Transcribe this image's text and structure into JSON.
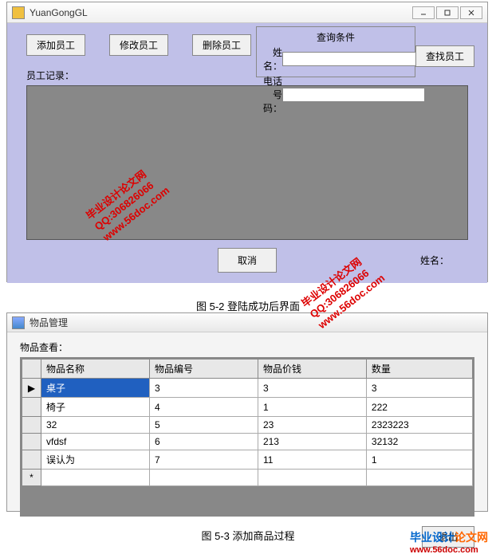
{
  "window1": {
    "title": "YuanGongGL",
    "buttons": {
      "add": "添加员工",
      "edit": "修改员工",
      "delete": "删除员工",
      "search": "查找员工",
      "cancel": "取消"
    },
    "queryGroup": {
      "title": "查询条件",
      "nameLabel": "姓名：",
      "phoneLabel": "电话号码：",
      "nameVal": "",
      "phoneVal": ""
    },
    "recordsLabel": "员工记录：",
    "bottomNameLabel": "姓名："
  },
  "caption1": "图 5-2 登陆成功后界面",
  "window2": {
    "title": "物品管理",
    "viewLabel": "物品查看：",
    "headers": [
      "物品名称",
      "物品编号",
      "物品价钱",
      "数量"
    ],
    "rows": [
      {
        "marker": "▶",
        "cells": [
          "桌子",
          "3",
          "3",
          "3"
        ],
        "selected": true
      },
      {
        "marker": "",
        "cells": [
          "椅子",
          "4",
          "1",
          "222"
        ],
        "selected": false
      },
      {
        "marker": "",
        "cells": [
          "32",
          "5",
          "23",
          "2323223"
        ],
        "selected": false
      },
      {
        "marker": "",
        "cells": [
          "vfdsf",
          "6",
          "213",
          "32132"
        ],
        "selected": false
      },
      {
        "marker": "",
        "cells": [
          "误认为",
          "7",
          "11",
          "1"
        ],
        "selected": false
      },
      {
        "marker": "*",
        "cells": [
          "",
          "",
          "",
          ""
        ],
        "selected": false
      }
    ],
    "exit": "退出"
  },
  "caption2": "图 5-3 添加商品过程",
  "watermark": {
    "line1": "毕业设计论文网",
    "line2": "QQ:306826066",
    "line3": "www.56doc.com"
  },
  "logoWm": {
    "text1": "毕业设计",
    "text2": "论文网",
    "url": "www.56doc.com"
  }
}
